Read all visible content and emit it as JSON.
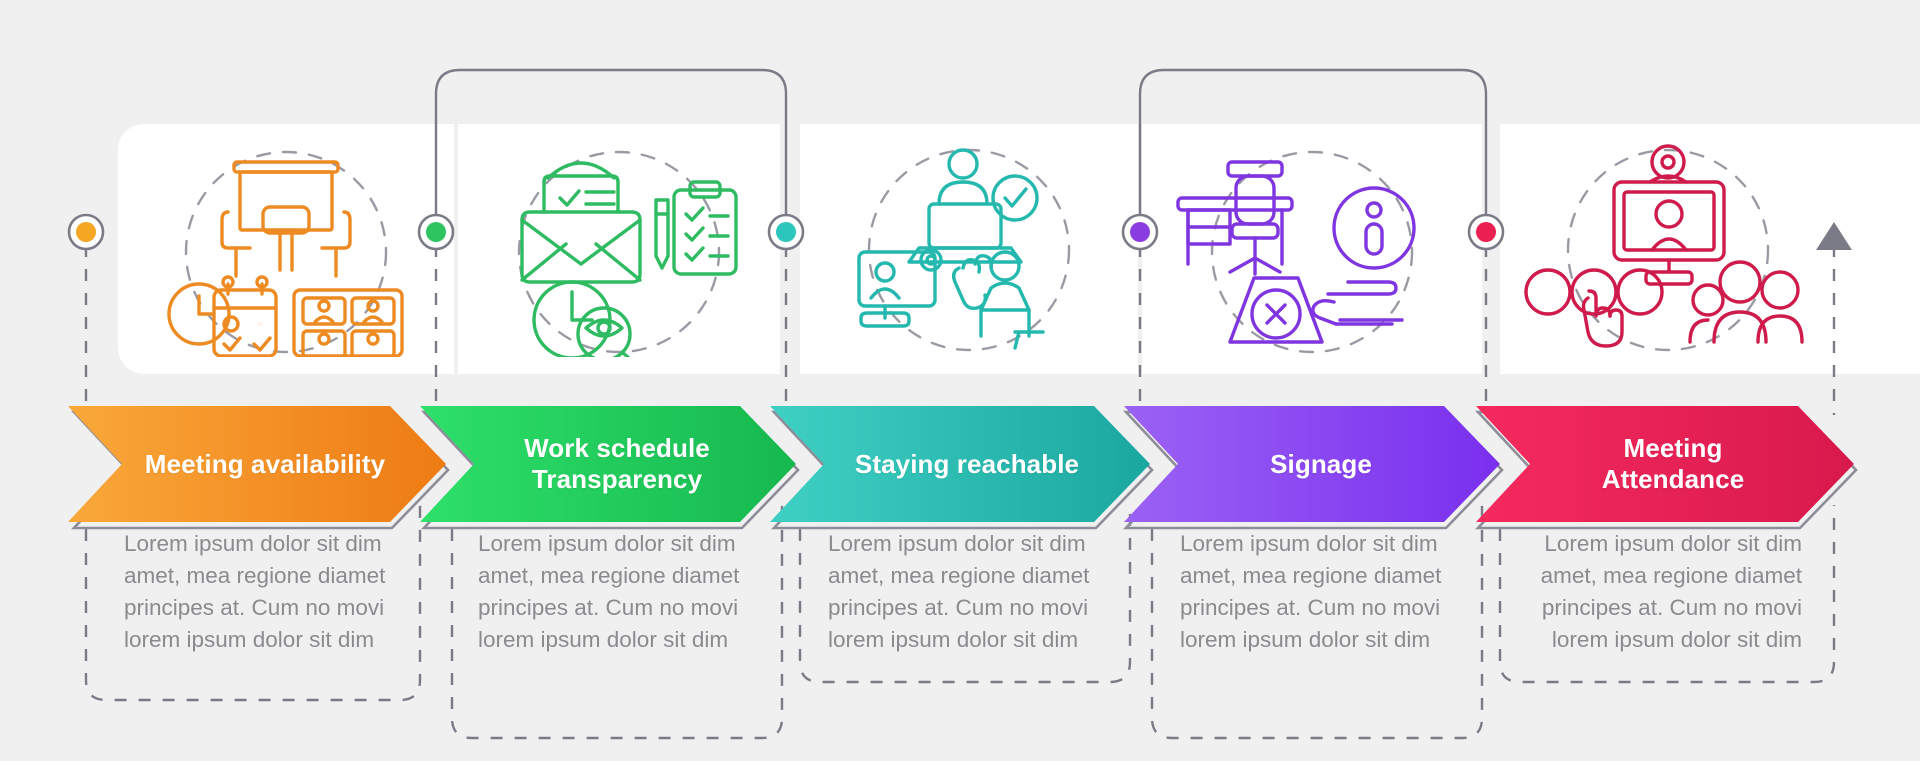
{
  "page": {
    "background": "#f0f0f0",
    "card_background": "#ffffff",
    "connector_color": "#7b7b87",
    "body_text_color": "#8a8a8f"
  },
  "chart_data": {
    "type": "table",
    "title": "",
    "steps": [
      {
        "index": 1,
        "label": "Meeting availability",
        "color": "#f08a1e",
        "color_light": "#f9a83a",
        "color_dark": "#ee7b14",
        "marker_color": "#f5a623",
        "icon": "presentation-board-clock-calendar-video-grid-icon",
        "body": "Lorem ipsum dolor sit dim amet, mea regione diamet principes at. Cum no movi lorem ipsum dolor sit dim"
      },
      {
        "index": 2,
        "label": "Work schedule Transparency",
        "label_line1": "Work schedule",
        "label_line2": "Transparency",
        "color": "#22c55e",
        "color_light": "#2ee06a",
        "color_dark": "#16a34a",
        "marker_color": "#2ec45f",
        "icon": "envelope-checklist-clock-eye-icon",
        "body": "Lorem ipsum dolor sit dim amet, mea regione diamet principes at. Cum no movi lorem ipsum dolor sit dim"
      },
      {
        "index": 3,
        "label": "Staying reachable",
        "color": "#2bbcb4",
        "color_light": "#3fd0c4",
        "color_dark": "#1aa79f",
        "marker_color": "#2dc6bd",
        "icon": "laptop-person-check-webcam-chat-icon",
        "body": "Lorem ipsum dolor sit dim amet, mea regione diamet principes at. Cum no movi lorem ipsum dolor sit dim"
      },
      {
        "index": 4,
        "label": "Signage",
        "color": "#8b4ef0",
        "color_light": "#9b62f5",
        "color_dark": "#7a33ec",
        "marker_color": "#8b3ce0",
        "icon": "desk-chair-info-sign-hand-icon",
        "body": "Lorem ipsum dolor sit dim amet, mea regione diamet principes at. Cum no movi lorem ipsum dolor sit dim"
      },
      {
        "index": 5,
        "label": "Meeting Attendance",
        "label_line1": "Meeting",
        "label_line2": "Attendance",
        "color": "#ea1f52",
        "color_light": "#f52a5e",
        "color_dark": "#d8194c",
        "marker_color": "#ea1f52",
        "icon": "monitor-webcam-audience-touch-icon",
        "body": "Lorem ipsum dolor sit dim amet, mea regione diamet principes at. Cum no movi lorem ipsum dolor sit dim"
      }
    ],
    "end_marker": "triangle-up-arrow"
  }
}
